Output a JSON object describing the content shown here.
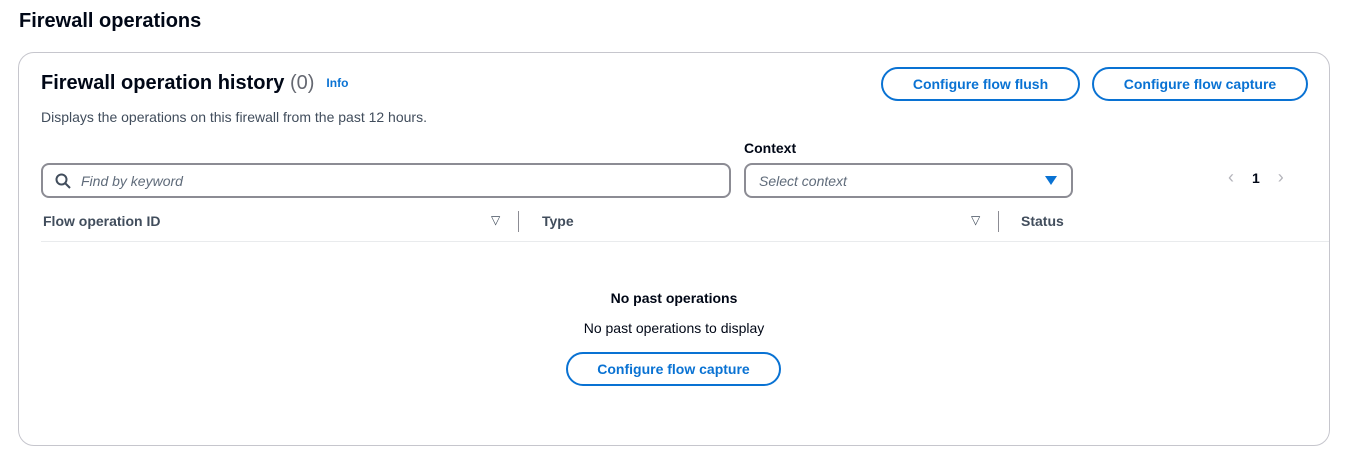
{
  "section_title": "Firewall operations",
  "panel": {
    "title": "Firewall operation history",
    "count": "(0)",
    "info": "Info",
    "description": "Displays the operations on this firewall from the past 12 hours.",
    "buttons": {
      "flush": "Configure flow flush",
      "capture": "Configure flow capture"
    }
  },
  "filter": {
    "search_placeholder": "Find by keyword",
    "context_label": "Context",
    "context_placeholder": "Select context"
  },
  "pagination": {
    "current": "1"
  },
  "table": {
    "columns": [
      "Flow operation ID",
      "Type",
      "Status"
    ]
  },
  "empty": {
    "title": "No past operations",
    "message": "No past operations to display",
    "button": "Configure flow capture"
  }
}
